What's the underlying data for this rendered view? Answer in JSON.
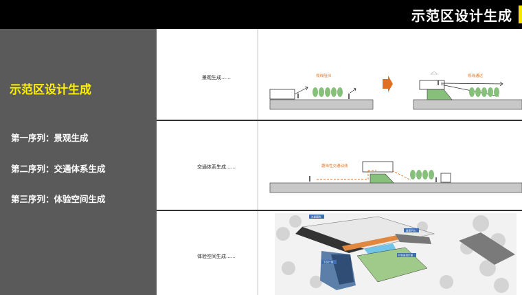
{
  "header": {
    "title": "示范区设计生成"
  },
  "sidebar": {
    "heading": "示范区设计生成",
    "items": [
      {
        "label": "第一序列：景观生成"
      },
      {
        "label": "第二序列：交通体系生成"
      },
      {
        "label": "第三序列：体验空间生成"
      }
    ]
  },
  "rows": [
    {
      "label": "景观生成……",
      "annotations": {
        "left": "视线阻挡",
        "right": "视线通达"
      }
    },
    {
      "label": "交通体系生成……",
      "annotations": {
        "center": "趣味性交通动线"
      }
    },
    {
      "label": "体验空间生成……",
      "annotations": {
        "tag1": "水景庭院",
        "tag2": "下沉广场",
        "tag3": "景观平台",
        "tag4": "特色景观步道"
      }
    }
  ],
  "colors": {
    "accent_yellow": "#ffef00",
    "sidebar_bg": "#5a5a5a",
    "annotation_orange": "#e0792b",
    "tree_green": "#86c07a",
    "arrow_orange": "#e07020"
  }
}
